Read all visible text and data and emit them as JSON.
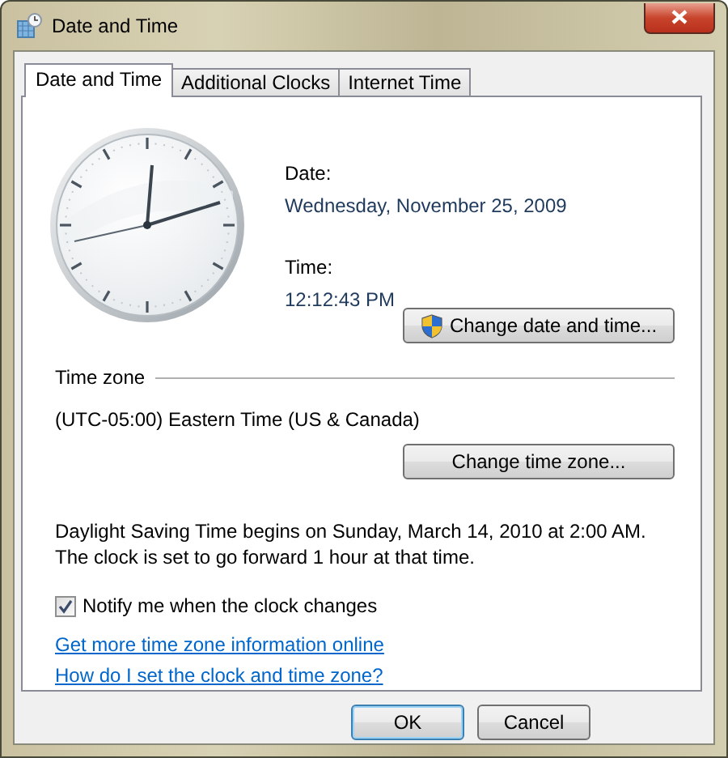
{
  "window": {
    "title": "Date and Time"
  },
  "tabs": [
    {
      "label": "Date and Time",
      "selected": true
    },
    {
      "label": "Additional Clocks",
      "selected": false
    },
    {
      "label": "Internet Time",
      "selected": false
    }
  ],
  "date": {
    "label": "Date:",
    "value": "Wednesday, November 25, 2009"
  },
  "time": {
    "label": "Time:",
    "value": "12:12:43 PM"
  },
  "change_datetime_button": "Change date and time...",
  "time_zone": {
    "heading": "Time zone",
    "value": "(UTC-05:00) Eastern Time (US & Canada)",
    "button": "Change time zone..."
  },
  "dst_notice": "Daylight Saving Time begins on Sunday, March 14, 2010 at 2:00 AM. The clock is set to go forward 1 hour at that time.",
  "notify_checkbox": {
    "label": "Notify me when the clock changes",
    "checked": true
  },
  "links": [
    "Get more time zone information online",
    "How do I set the clock and time zone?"
  ],
  "buttons": [
    {
      "label": "OK",
      "default": true
    },
    {
      "label": "Cancel",
      "default": false
    }
  ]
}
